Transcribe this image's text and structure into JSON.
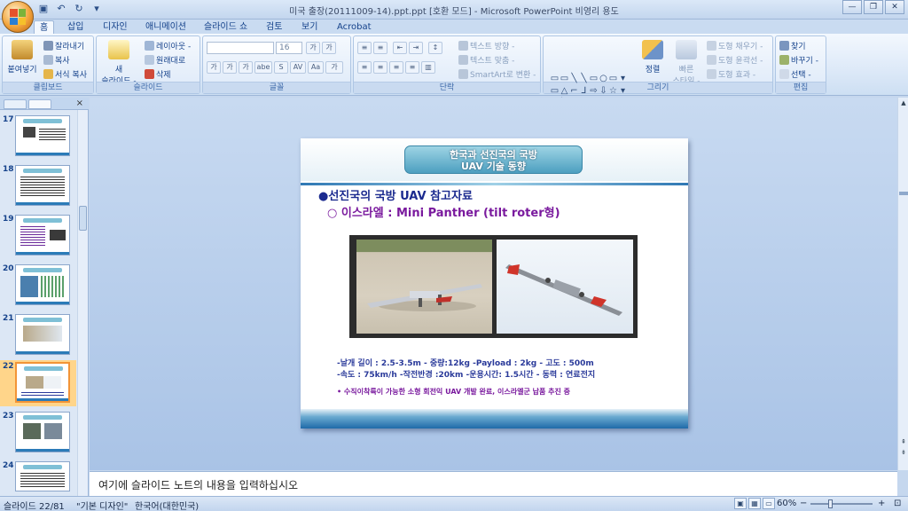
{
  "title_bar": {
    "title": "미국 출장(20111009-14).ppt.ppt [호환 모드] - Microsoft PowerPoint 비영리 용도",
    "qat_icons": [
      "save-icon",
      "undo-icon",
      "redo-icon",
      "dropdown-icon"
    ],
    "min_glyph": "—",
    "max_glyph": "❐",
    "close_glyph": "✕"
  },
  "tabs": [
    "홈",
    "삽입",
    "디자인",
    "애니메이션",
    "슬라이드 쇼",
    "검토",
    "보기",
    "Acrobat"
  ],
  "ribbon": {
    "clipboard": {
      "label": "클립보드",
      "paste": "붙여넣기",
      "cut": "잘라내기",
      "copy": "복사",
      "format_painter": "서식 복사"
    },
    "slides": {
      "label": "슬라이드",
      "new_slide": "새\n슬라이드 -",
      "layout": "레이아웃 -",
      "reset": "원래대로",
      "delete": "삭제"
    },
    "font": {
      "label": "글꼴",
      "font_size": "16",
      "grow": "가",
      "shrink": "가",
      "clear": "가",
      "b": "가",
      "i": "가",
      "u": "가",
      "s": "abe",
      "shadow": "S",
      "spacing": "AV",
      "case": "Aa",
      "color": "가"
    },
    "paragraph": {
      "label": "단락",
      "text_direction": "텍스트 방향 -",
      "align_text": "텍스트 맞춤 -",
      "smartart": "SmartArt로 변환 -"
    },
    "drawing": {
      "label": "그리기",
      "arrange": "정렬",
      "quick_styles": "빠른\n스타일 -",
      "shape_fill": "도형 채우기 -",
      "shape_outline": "도형 윤곽선 -",
      "shape_effects": "도형 효과 -",
      "shapes": [
        "▭",
        "▭",
        "╲",
        "╲",
        "▭",
        "○",
        "▭",
        "⊳",
        "▭",
        "△",
        "⌐",
        "⅃",
        "⇨",
        "⇩",
        "☆",
        "◟",
        "╲",
        "⌒",
        "⌒",
        "{",
        "}",
        "☆",
        "▾",
        "▾"
      ]
    },
    "editing": {
      "label": "편집",
      "find": "찾기",
      "replace": "바꾸기 -",
      "select": "선택 -"
    }
  },
  "slide_panel": {
    "tab_outline_icon": "outline-icon",
    "tab_slides_icon": "slides-icon",
    "close_glyph": "×",
    "thumbnails": [
      {
        "num": "17",
        "selected": false
      },
      {
        "num": "18",
        "selected": false
      },
      {
        "num": "19",
        "selected": false
      },
      {
        "num": "20",
        "selected": false
      },
      {
        "num": "21",
        "selected": false
      },
      {
        "num": "22",
        "selected": true
      },
      {
        "num": "23",
        "selected": false
      },
      {
        "num": "24",
        "selected": false
      }
    ]
  },
  "slide": {
    "title_line1": "한국과 선진국의 국방",
    "title_line2": "UAV 기술 동향",
    "heading": "●선진국의 국방 UAV 참고자료",
    "subheading": "○ 이스라엘 : Mini Panther (tilt roter형)",
    "spec_line1": "-날개 길이 : 2.5-3.5m   - 중량:12kg    -Payload : 2kg  - 고도 : 500m",
    "spec_line2": "-속도 : 75km/h      -작전반경 :20km  -운용시간: 1.5시간  - 동력 : 연료전지",
    "note": "•  수직이착륙이 가능한 소형 회전익 UAV 개발 완료, 이스라엘군 납품 추진 중"
  },
  "notes_placeholder": "여기에 슬라이드 노트의 내용을 입력하십시오",
  "status_bar": {
    "slide_counter": "슬라이드 22/81",
    "theme": "\"기본 디자인\"",
    "language": "한국어(대한민국)",
    "zoom": "60%",
    "zoom_out": "−",
    "zoom_in": "+",
    "view_icons": [
      "normal-view-icon",
      "slide-sorter-icon",
      "slideshow-icon"
    ]
  }
}
